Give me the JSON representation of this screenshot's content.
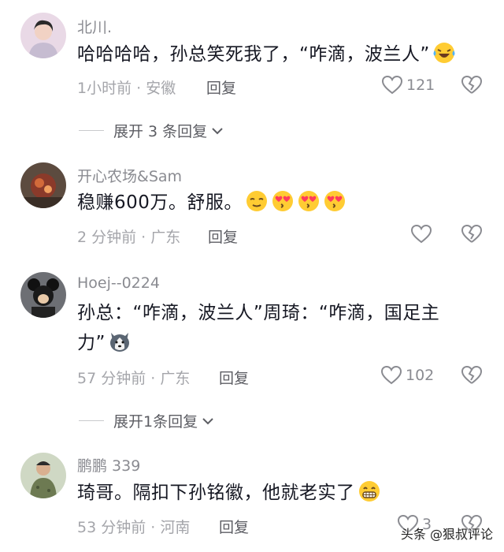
{
  "comments": [
    {
      "username": "北川.",
      "text": "哈哈哈哈，孙总笑死我了，“咋滴，波兰人”",
      "emojis": [
        "laugh-cry-emoji"
      ],
      "meta": "1小时前 · 安徽",
      "reply_label": "回复",
      "likes": "121",
      "expand_label": "展开 3 条回复"
    },
    {
      "username": "开心农场&Sam",
      "text": "稳赚600万。舒服。",
      "emojis": [
        "relieved-emoji",
        "heart-eyes-emoji",
        "heart-eyes-emoji",
        "heart-eyes-emoji"
      ],
      "meta": "2 分钟前 · 广东",
      "reply_label": "回复",
      "likes": ""
    },
    {
      "username": "Hoej--0224",
      "text": "孙总：“咋滴，波兰人”周琦：“咋滴，国足主力”",
      "emojis": [
        "husky-emoji"
      ],
      "meta": "57 分钟前 · 广东",
      "reply_label": "回复",
      "likes": "102",
      "expand_label": "展开1条回复"
    },
    {
      "username": "鹏鹏 339",
      "text": "琦哥。隔扣下孙铭徽，他就老实了",
      "emojis": [
        "grin-emoji"
      ],
      "meta": "53 分钟前 · 河南",
      "reply_label": "回复",
      "likes": "3"
    }
  ],
  "watermark": "头条 @狠叔评论",
  "colors": {
    "text": "#161823",
    "meta": "#a4a5aa",
    "username": "#8a8b91"
  }
}
